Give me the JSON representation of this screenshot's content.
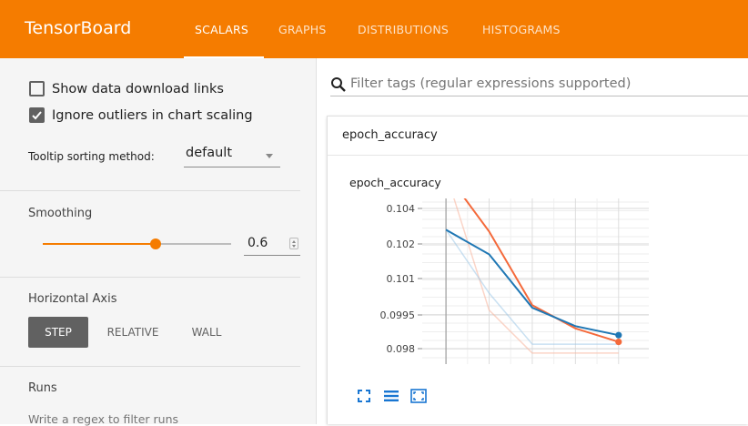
{
  "app": {
    "title": "TensorBoard"
  },
  "tabs": [
    {
      "label": "SCALARS",
      "active": true
    },
    {
      "label": "GRAPHS",
      "active": false
    },
    {
      "label": "DISTRIBUTIONS",
      "active": false
    },
    {
      "label": "HISTOGRAMS",
      "active": false
    }
  ],
  "sidebar": {
    "show_download_links": {
      "label": "Show data download links",
      "checked": false
    },
    "ignore_outliers": {
      "label": "Ignore outliers in chart scaling",
      "checked": true
    },
    "tooltip_sorting": {
      "label": "Tooltip sorting method:",
      "value": "default"
    },
    "smoothing": {
      "title": "Smoothing",
      "value": "0.6",
      "fraction": 0.6
    },
    "horizontal_axis": {
      "title": "Horizontal Axis",
      "options": [
        {
          "label": "STEP",
          "active": true
        },
        {
          "label": "RELATIVE",
          "active": false
        },
        {
          "label": "WALL",
          "active": false
        }
      ]
    },
    "runs": {
      "title": "Runs",
      "hint": "Write a regex to filter runs"
    }
  },
  "filter": {
    "placeholder": "Filter tags (regular expressions supported)"
  },
  "card": {
    "header": "epoch_accuracy"
  },
  "chart_data": {
    "type": "line",
    "title": "epoch_accuracy",
    "xlabel": "",
    "ylabel": "",
    "y_ticks": [
      "0.104",
      "0.102",
      "0.101",
      "0.0995",
      "0.098"
    ],
    "grid": true,
    "colors": {
      "run_orange": "#f4693a",
      "run_blue": "#1f77b4",
      "accent": "#f57c00"
    },
    "series": [
      {
        "color": "orange",
        "values": [
          {
            "x": 0,
            "y": 0.106
          },
          {
            "x": 1,
            "y": 0.1027
          },
          {
            "x": 2,
            "y": 0.0999
          },
          {
            "x": 3,
            "y": 0.0989
          },
          {
            "x": 4,
            "y": 0.0983
          }
        ]
      },
      {
        "color": "blue",
        "values": [
          {
            "x": 0,
            "y": 0.1028
          },
          {
            "x": 1,
            "y": 0.1017
          },
          {
            "x": 2,
            "y": 0.0998
          },
          {
            "x": 3,
            "y": 0.099
          },
          {
            "x": 4,
            "y": 0.0986
          }
        ]
      },
      {
        "color": "blue-raw",
        "values": [
          {
            "x": 0,
            "y": 0.1028
          },
          {
            "x": 1,
            "y": 0.1004
          },
          {
            "x": 2,
            "y": 0.0982
          },
          {
            "x": 3,
            "y": 0.0982
          },
          {
            "x": 4,
            "y": 0.0982
          }
        ]
      },
      {
        "color": "orange-raw",
        "values": [
          {
            "x": 0,
            "y": 0.106
          },
          {
            "x": 1,
            "y": 0.0997
          },
          {
            "x": 2,
            "y": 0.0978
          },
          {
            "x": 3,
            "y": 0.0978
          },
          {
            "x": 4,
            "y": 0.0978
          }
        ]
      }
    ],
    "toolbar_icons": [
      "fit-to-data-icon",
      "toggle-log-scale-icon",
      "expand-chart-icon"
    ]
  }
}
